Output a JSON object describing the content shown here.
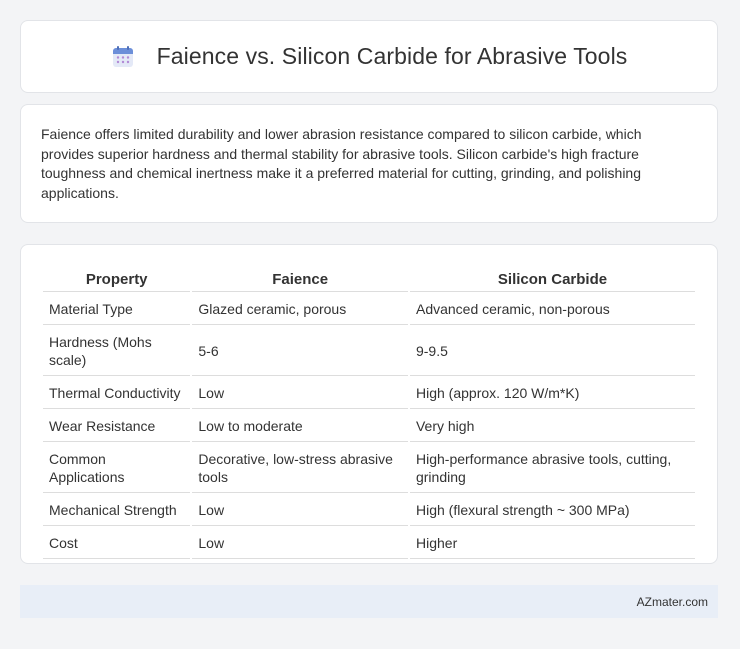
{
  "header": {
    "title": "Faience vs. Silicon Carbide for Abrasive Tools",
    "icon": "calendar-icon"
  },
  "intro": {
    "text": "Faience offers limited durability and lower abrasion resistance compared to silicon carbide, which provides superior hardness and thermal stability for abrasive tools. Silicon carbide's high fracture toughness and chemical inertness make it a preferred material for cutting, grinding, and polishing applications."
  },
  "table": {
    "headers": [
      "Property",
      "Faience",
      "Silicon Carbide"
    ],
    "rows": [
      [
        "Material Type",
        "Glazed ceramic, porous",
        "Advanced ceramic, non-porous"
      ],
      [
        "Hardness (Mohs scale)",
        "5-6",
        "9-9.5"
      ],
      [
        "Thermal Conductivity",
        "Low",
        "High (approx. 120 W/m*K)"
      ],
      [
        "Wear Resistance",
        "Low to moderate",
        "Very high"
      ],
      [
        "Common Applications",
        "Decorative, low-stress abrasive tools",
        "High-performance abrasive tools, cutting, grinding"
      ],
      [
        "Mechanical Strength",
        "Low",
        "High (flexural strength ~ 300 MPa)"
      ],
      [
        "Cost",
        "Low",
        "Higher"
      ]
    ]
  },
  "footer": {
    "site": "AZmater.com"
  },
  "colors": {
    "background": "#f3f4f6",
    "card": "#ffffff",
    "footer": "#e8eef7",
    "icon_top": "#6a8fd8",
    "icon_body": "#dfe6f7"
  }
}
